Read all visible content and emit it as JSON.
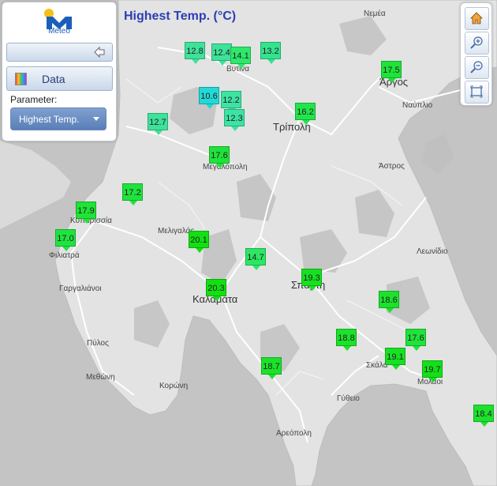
{
  "map": {
    "title": "Highest Temp. (°C)",
    "colors": {
      "land": "#e3e3e3",
      "sea": "#c4c4c4",
      "road": "#ffffff",
      "forest": "#b9b9b9"
    }
  },
  "panel": {
    "logo_text": "Meteo",
    "data_button": "Data",
    "parameter_label": "Parameter:",
    "parameter_value": "Highest Temp."
  },
  "tools": {
    "home": "home-icon",
    "zoom_in": "zoom-in-icon",
    "zoom_out": "zoom-out-icon",
    "extent": "extent-icon"
  },
  "places": [
    {
      "name": "Νεμέα",
      "big": false
    },
    {
      "name": "Βυτίνα",
      "big": false
    },
    {
      "name": "Άργος",
      "big": true
    },
    {
      "name": "Ναύπλιο",
      "big": false
    },
    {
      "name": "Τρίπολη",
      "big": true
    },
    {
      "name": "Μεγαλόπολη",
      "big": false
    },
    {
      "name": "Άστρος",
      "big": false
    },
    {
      "name": "Κυπαρισσία",
      "big": false
    },
    {
      "name": "Μελιγαλάς",
      "big": false
    },
    {
      "name": "Φιλιατρά",
      "big": false
    },
    {
      "name": "Λεωνίδιο",
      "big": false
    },
    {
      "name": "Σπάρτη",
      "big": true
    },
    {
      "name": "Γαργαλιάνοι",
      "big": false
    },
    {
      "name": "Καλαμάτα",
      "big": true
    },
    {
      "name": "Πύλος",
      "big": false
    },
    {
      "name": "Σκάλα",
      "big": false
    },
    {
      "name": "Μεθώνη",
      "big": false
    },
    {
      "name": "Μολάοι",
      "big": false
    },
    {
      "name": "Κορώνη",
      "big": false
    },
    {
      "name": "Γύθειο",
      "big": false
    },
    {
      "name": "Αρεόπολη",
      "big": false
    }
  ],
  "stations": [
    {
      "value": "12.8",
      "color": "#3ee29a"
    },
    {
      "value": "12.4",
      "color": "#3ee29a"
    },
    {
      "value": "14.1",
      "color": "#2ee86a"
    },
    {
      "value": "13.2",
      "color": "#34e38f"
    },
    {
      "value": "17.5",
      "color": "#1fe33a"
    },
    {
      "value": "10.6",
      "color": "#22d9d6"
    },
    {
      "value": "12.2",
      "color": "#3de3a2"
    },
    {
      "value": "12.3",
      "color": "#3de3a2"
    },
    {
      "value": "12.7",
      "color": "#3ee29a"
    },
    {
      "value": "16.2",
      "color": "#22e44c"
    },
    {
      "value": "17.6",
      "color": "#1fe33a"
    },
    {
      "value": "17.2",
      "color": "#20e33e"
    },
    {
      "value": "17.9",
      "color": "#1fe336"
    },
    {
      "value": "17.0",
      "color": "#20e33f"
    },
    {
      "value": "20.1",
      "color": "#12e012"
    },
    {
      "value": "14.7",
      "color": "#2be765"
    },
    {
      "value": "19.3",
      "color": "#16e120"
    },
    {
      "value": "20.3",
      "color": "#12e012"
    },
    {
      "value": "18.6",
      "color": "#1ce22c"
    },
    {
      "value": "18.8",
      "color": "#1be22a"
    },
    {
      "value": "17.6",
      "color": "#1fe33a"
    },
    {
      "value": "19.1",
      "color": "#17e122"
    },
    {
      "value": "19.7",
      "color": "#14e01a"
    },
    {
      "value": "18.7",
      "color": "#1be22b"
    },
    {
      "value": "18.4",
      "color": "#1ce22e"
    }
  ]
}
